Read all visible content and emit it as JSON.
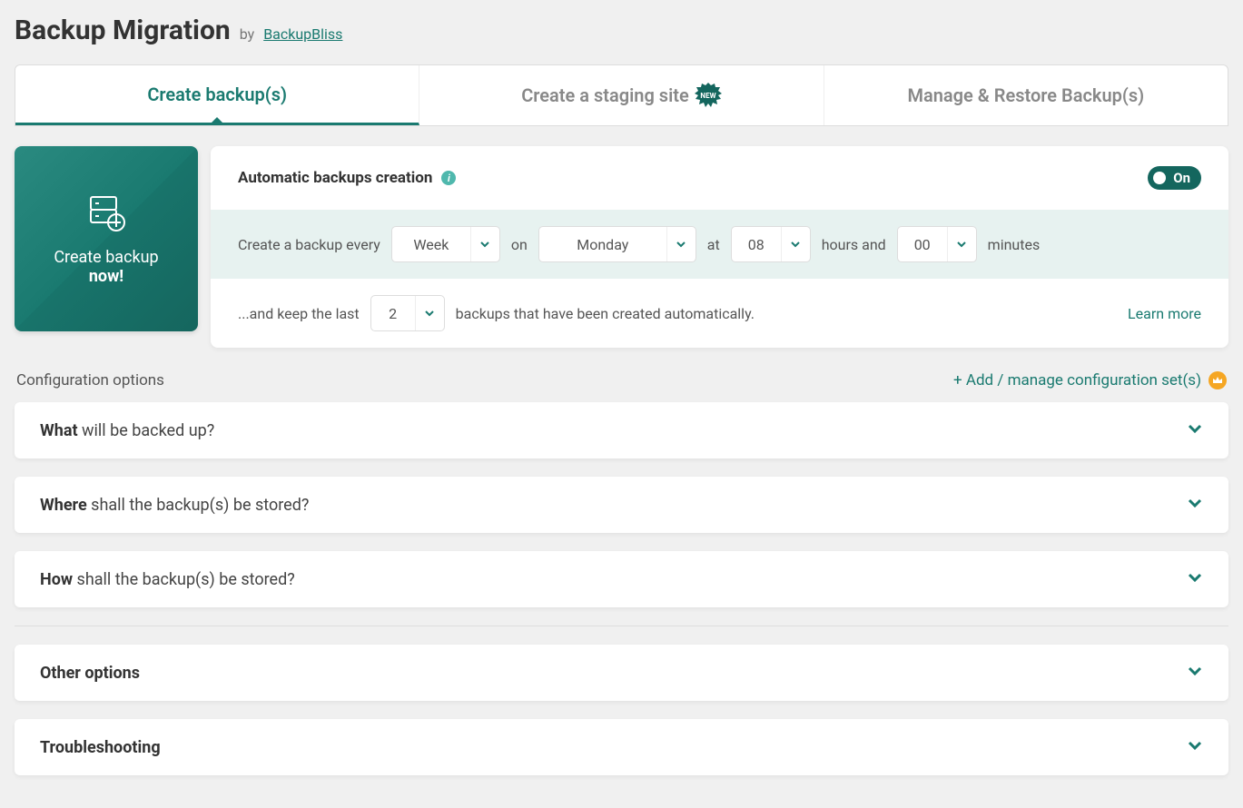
{
  "header": {
    "title": "Backup Migration",
    "by": "by",
    "author": "BackupBliss"
  },
  "tabs": {
    "create": "Create backup(s)",
    "staging": "Create a staging site",
    "staging_badge": "NEW",
    "manage": "Manage & Restore Backup(s)"
  },
  "create_now": {
    "line1": "Create backup",
    "line2": "now!"
  },
  "auto": {
    "title": "Automatic backups creation",
    "toggle": "On",
    "every_prefix": "Create a backup every",
    "every_value": "Week",
    "on_label": "on",
    "day_value": "Monday",
    "at_label": "at",
    "hours_value": "08",
    "hours_suffix": "hours and",
    "minutes_value": "00",
    "minutes_suffix": "minutes",
    "keep_prefix": "...and keep the last",
    "keep_value": "2",
    "keep_suffix": "backups that have been created automatically.",
    "learn_more": "Learn more"
  },
  "config": {
    "title": "Configuration options",
    "add_manage": "+ Add / manage configuration set(s)"
  },
  "accordions": {
    "what_b": "What",
    "what_rest": " will be backed up?",
    "where_b": "Where",
    "where_rest": " shall the backup(s) be stored?",
    "how_b": "How",
    "how_rest": " shall the backup(s) be stored?",
    "other": "Other options",
    "trouble": "Troubleshooting"
  }
}
